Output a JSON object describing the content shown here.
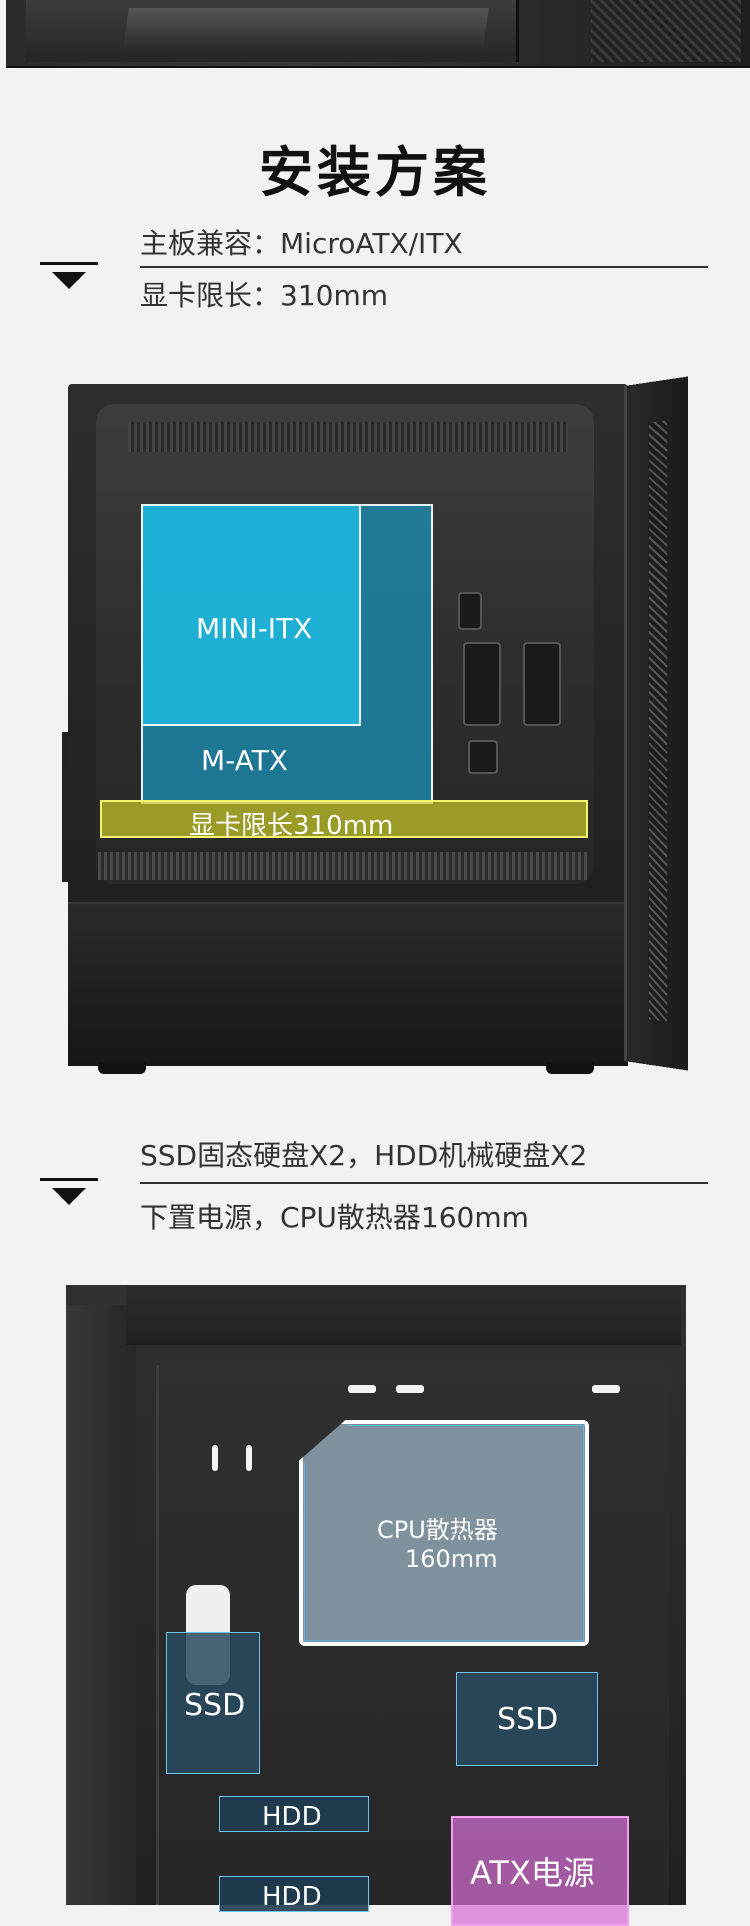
{
  "section_title": "安装方案",
  "spec1": {
    "line1": "主板兼容：MicroATX/ITX",
    "line2": "显卡限长：310mm"
  },
  "diagram1": {
    "mini_itx_label": "MINI-ITX",
    "matx_label": "M-ATX",
    "gpu_label": "显卡限长310mm",
    "colors": {
      "mini_itx": "#1eb9e1",
      "matx": "#1996be",
      "gpu": "#c8c828"
    }
  },
  "spec2": {
    "line1": "SSD固态硬盘X2，HDD机械硬盘X2",
    "line2": "下置电源，CPU散热器160mm"
  },
  "diagram2": {
    "cpu_label_line1": "CPU散热器",
    "cpu_label_line2": "160mm",
    "ssd_left_label": "SSD",
    "ssd_right_label": "SSD",
    "hdd1_label": "HDD",
    "hdd2_label": "HDD",
    "psu_label": "ATX电源",
    "colors": {
      "cpu": "#7f919d",
      "ssd": "#284b5f",
      "psu": "#d26ed2"
    }
  }
}
